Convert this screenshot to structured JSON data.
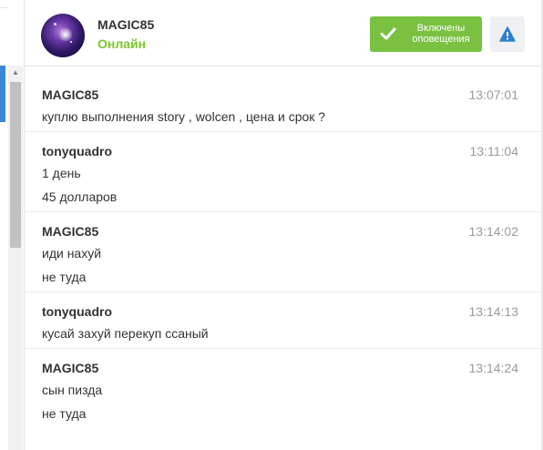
{
  "header": {
    "user_name": "MAGIC85",
    "user_status": "Онлайн",
    "notify_button_label_line1": "Включены",
    "notify_button_label_line2": "оповещения"
  },
  "messages": [
    {
      "author": "MAGIC85",
      "time": "13:07:01",
      "lines": [
        "куплю выполнения story , wolcen , цена и срок ?"
      ]
    },
    {
      "author": "tonyquadro",
      "time": "13:11:04",
      "lines": [
        "1 день",
        "45 долларов"
      ]
    },
    {
      "author": "MAGIC85",
      "time": "13:14:02",
      "lines": [
        "иди нахуй",
        "не туда"
      ]
    },
    {
      "author": "tonyquadro",
      "time": "13:14:13",
      "lines": [
        "кусай захуй перекуп ссаный"
      ]
    },
    {
      "author": "MAGIC85",
      "time": "13:14:24",
      "lines": [
        "сын пизда",
        "не туда"
      ]
    }
  ],
  "icons": {
    "notify": "check-icon",
    "alert": "warning-icon",
    "avatar": "avatar-image"
  },
  "colors": {
    "status_online": "#7cc72b",
    "notify_button": "#7ac142",
    "alert_icon": "#2f7fd1"
  }
}
